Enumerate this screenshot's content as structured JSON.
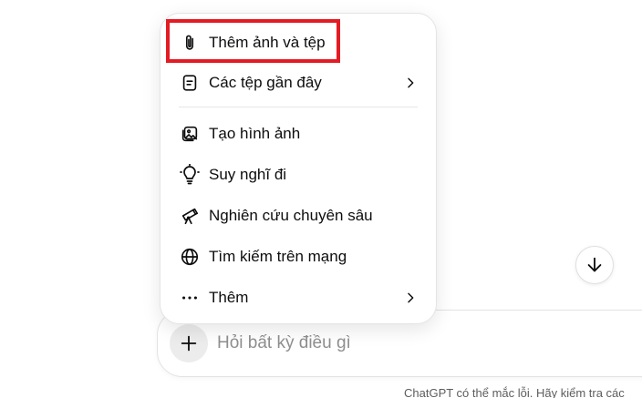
{
  "menu": {
    "items": [
      {
        "label": "Thêm ảnh và tệp",
        "icon": "paperclip-icon",
        "has_submenu": false
      },
      {
        "label": "Các tệp gần đây",
        "icon": "document-icon",
        "has_submenu": true
      },
      {
        "label": "Tạo hình ảnh",
        "icon": "image-create-icon",
        "has_submenu": false
      },
      {
        "label": "Suy nghĩ đi",
        "icon": "lightbulb-icon",
        "has_submenu": false
      },
      {
        "label": "Nghiên cứu chuyên sâu",
        "icon": "telescope-icon",
        "has_submenu": false
      },
      {
        "label": "Tìm kiếm trên mạng",
        "icon": "globe-icon",
        "has_submenu": false
      },
      {
        "label": "Thêm",
        "icon": "more-dots-icon",
        "has_submenu": true
      }
    ]
  },
  "composer": {
    "placeholder": "Hỏi bất kỳ điều gì",
    "plus_icon": "plus-icon"
  },
  "scroll_button": {
    "icon": "arrow-down-icon"
  },
  "footer": {
    "note": "ChatGPT có thể mắc lỗi. Hãy kiểm tra các"
  },
  "colors": {
    "highlight": "#e31b23",
    "text": "#0d0d0d",
    "placeholder": "#8f8f8f",
    "plus_bg": "#ececec"
  }
}
